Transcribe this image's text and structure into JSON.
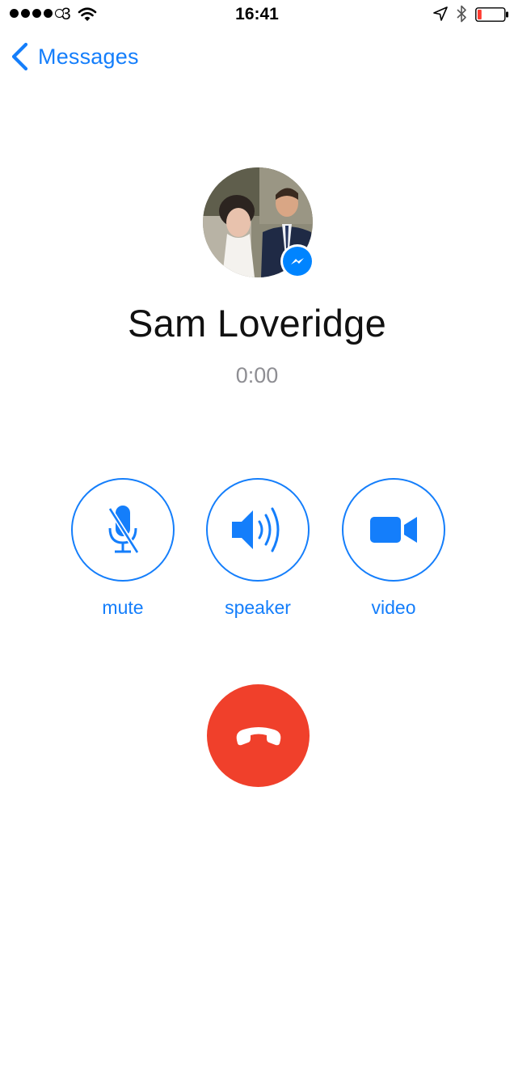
{
  "status_bar": {
    "signal_bars": 4,
    "signal_total": 5,
    "carrier": "3",
    "time": "16:41",
    "battery_level": 0.15,
    "icons": [
      "wifi-icon",
      "location-icon",
      "bluetooth-icon",
      "battery-icon"
    ]
  },
  "nav": {
    "back_label": "Messages",
    "back_icon": "chevron-left-icon"
  },
  "caller": {
    "name": "Sam Loveridge",
    "duration": "0:00",
    "avatar": "contact-photo",
    "badge_icon": "messenger-icon"
  },
  "controls": {
    "mute": {
      "label": "mute",
      "icon": "microphone-off-icon"
    },
    "speaker": {
      "label": "speaker",
      "icon": "speaker-icon"
    },
    "video": {
      "label": "video",
      "icon": "video-camera-icon"
    }
  },
  "end_call": {
    "icon": "hang-up-icon"
  },
  "colors": {
    "accent": "#147efb",
    "end_call": "#f0402b",
    "messenger": "#0084ff",
    "timer": "#8e8e93",
    "battery_low": "#ff3b30"
  }
}
